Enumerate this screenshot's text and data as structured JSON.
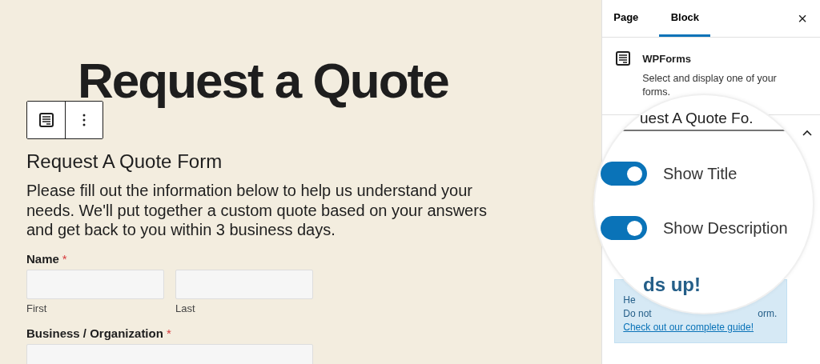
{
  "canvas": {
    "page_title": "Request a Quote",
    "form_title": "Request A Quote Form",
    "form_description": "Please fill out the information below to help us understand your needs. We'll put together a custom quote based on your answers and get back to you within 3 business days.",
    "fields": [
      {
        "kind": "name",
        "label": "Name",
        "required": true,
        "required_mark": "*",
        "sublabels": [
          "First",
          "Last"
        ]
      },
      {
        "kind": "single",
        "label": "Business / Organization",
        "required": true,
        "required_mark": "*"
      }
    ]
  },
  "sidebar": {
    "tabs": [
      {
        "label": "Page",
        "selected": false
      },
      {
        "label": "Block",
        "selected": true
      }
    ],
    "close": "×",
    "block": {
      "name": "WPForms",
      "description": "Select and display one of your forms."
    },
    "notice": {
      "heading_part": "He",
      "line_start": "Do not",
      "line_end": "orm.",
      "link": "Check out our complete guide!"
    }
  },
  "magnifier": {
    "form_select": "uest A Quote Fo.",
    "toggles": [
      {
        "label": "Show Title",
        "on": true
      },
      {
        "label": "Show Description",
        "on": true
      }
    ],
    "notice_heading_part": "ds up!"
  }
}
